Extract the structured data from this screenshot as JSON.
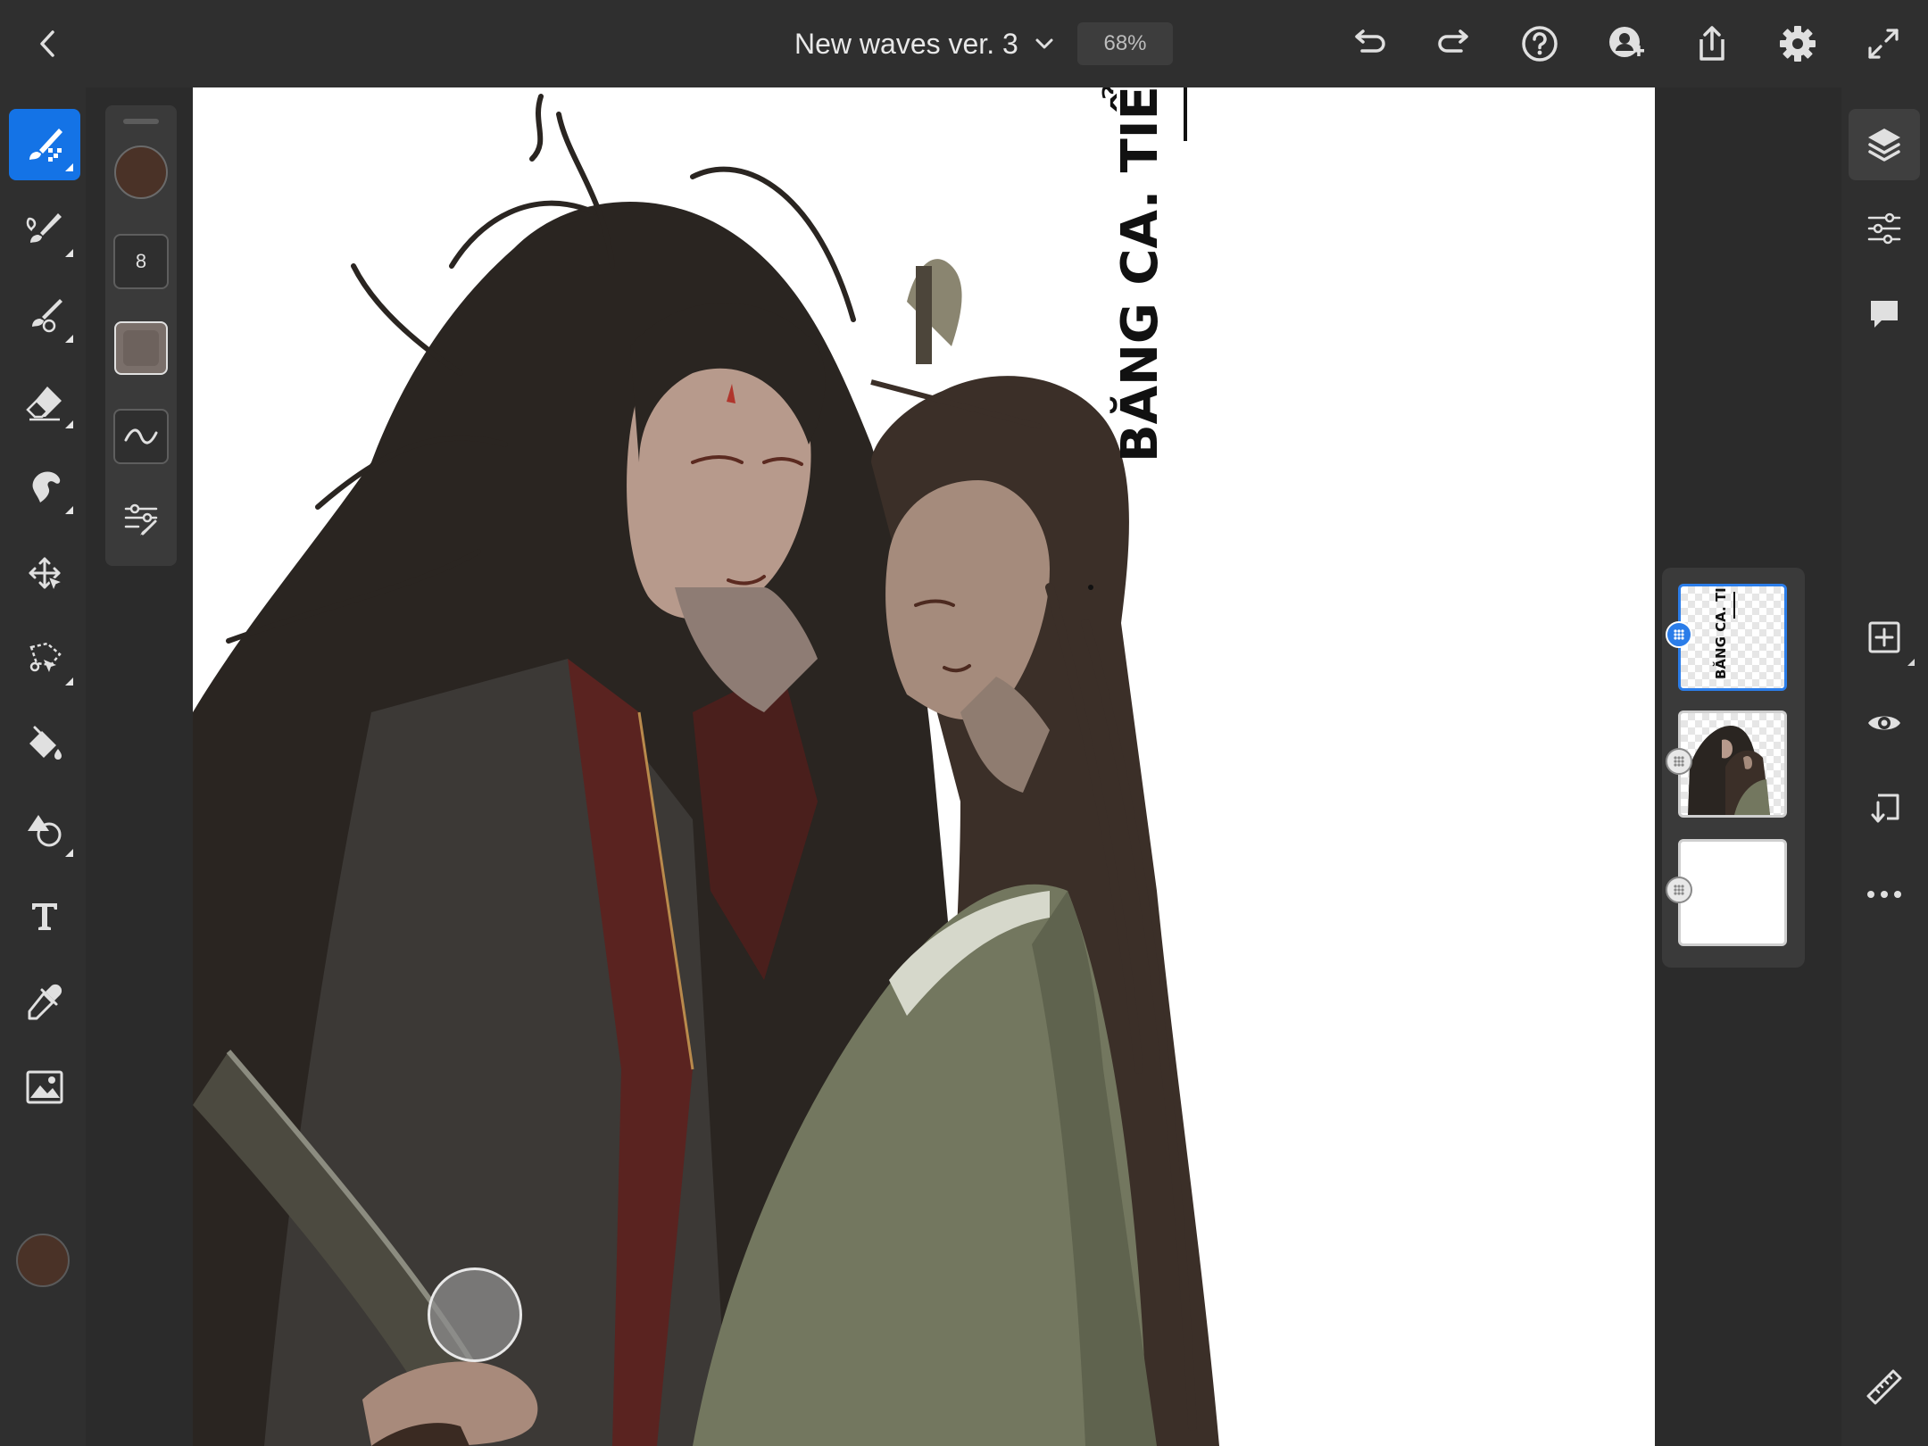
{
  "app": {
    "document_title": "New waves ver. 3",
    "zoom_level": "68%"
  },
  "top_bar": {
    "icons": [
      "back-icon",
      "title-dropdown-icon",
      "undo-icon",
      "redo-icon",
      "help-icon",
      "invite-user-icon",
      "share-icon",
      "settings-icon",
      "fullscreen-icon"
    ]
  },
  "left_toolbar": {
    "tools": [
      "pixel-brush-icon",
      "live-brush-icon",
      "vector-brush-icon",
      "eraser-icon",
      "smudge-icon",
      "transform-icon",
      "lasso-selection-icon",
      "fill-icon",
      "shape-icon",
      "text-icon",
      "eyedropper-icon",
      "place-image-icon"
    ],
    "active_tool": "pixel-brush-icon",
    "current_color": "#4a3227"
  },
  "tool_properties": {
    "brush_color": "#4a3227",
    "brush_size": "8",
    "icons": [
      "opacity-icon",
      "smoothing-icon",
      "brush-settings-icon"
    ]
  },
  "canvas": {
    "watermark_text": "BĂNG CA. TIỂU CỬU"
  },
  "layers": {
    "items": [
      {
        "name": "watermark-layer",
        "selected": true
      },
      {
        "name": "illustration-layer",
        "selected": false
      },
      {
        "name": "background-layer",
        "selected": false
      }
    ]
  },
  "right_toolbar": {
    "icons": [
      "layers-icon",
      "layer-properties-icon",
      "comments-icon",
      "add-layer-icon",
      "visibility-icon",
      "merge-down-icon",
      "more-options-icon",
      "ruler-icon"
    ]
  }
}
